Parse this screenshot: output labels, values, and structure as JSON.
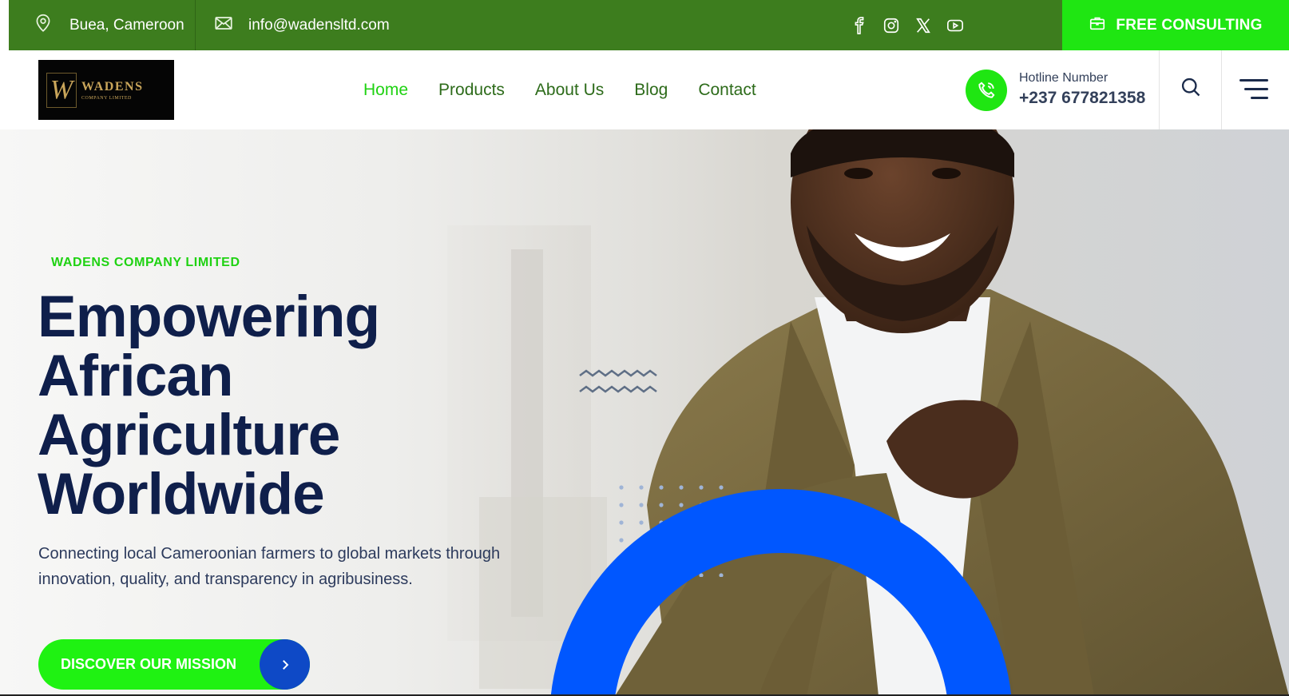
{
  "topbar": {
    "location": "Buea, Cameroon",
    "email": "info@wadensltd.com",
    "socials": [
      "facebook-icon",
      "instagram-icon",
      "x-icon",
      "youtube-icon"
    ],
    "consult_label": "FREE CONSULTING"
  },
  "header": {
    "logo": {
      "letter": "W",
      "name": "WADENS",
      "sub": "COMPANY LIMITED"
    },
    "nav": [
      {
        "label": "Home",
        "active": true
      },
      {
        "label": "Products",
        "active": false
      },
      {
        "label": "About Us",
        "active": false
      },
      {
        "label": "Blog",
        "active": false
      },
      {
        "label": "Contact",
        "active": false
      }
    ],
    "hotline_label": "Hotline Number",
    "hotline_number": "+237 677821358"
  },
  "hero": {
    "eyebrow": "WADENS COMPANY LIMITED",
    "headline_lines": [
      "Empowering",
      "African",
      "Agriculture",
      "Worldwide"
    ],
    "description": "Connecting local Cameroonian farmers to global markets through innovation, quality, and transparency in agribusiness.",
    "cta_label": "DISCOVER OUR MISSION"
  },
  "colors": {
    "topbar_green": "#3d7d1e",
    "accent_green": "#1fe612",
    "nav_green": "#2d6b1a",
    "navy": "#0f1f4b",
    "blue": "#0057ff"
  }
}
